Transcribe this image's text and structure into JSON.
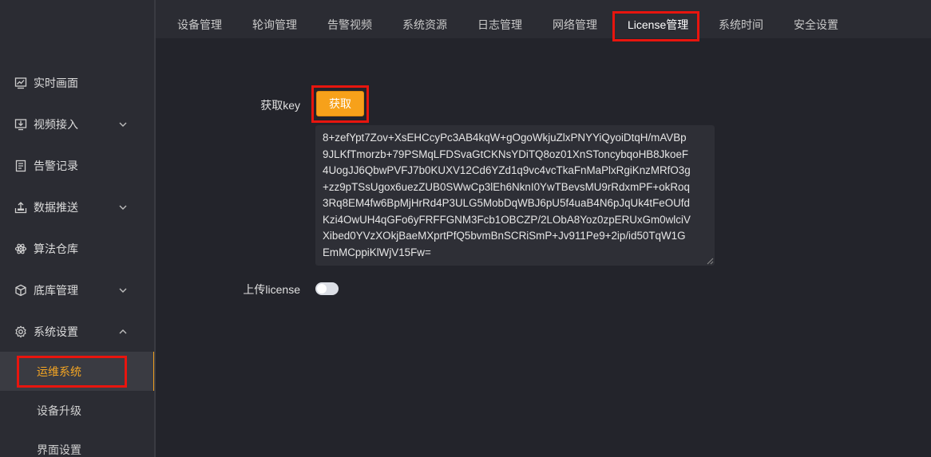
{
  "sidebar": {
    "items": [
      {
        "label": "实时画面",
        "icon": "monitor-chart-icon"
      },
      {
        "label": "视频接入",
        "icon": "screen-download-icon",
        "expandable": true
      },
      {
        "label": "告警记录",
        "icon": "document-list-icon"
      },
      {
        "label": "数据推送",
        "icon": "upload-tray-icon",
        "expandable": true
      },
      {
        "label": "算法仓库",
        "icon": "atom-icon"
      },
      {
        "label": "底库管理",
        "icon": "cube-icon",
        "expandable": true
      },
      {
        "label": "系统设置",
        "icon": "gear-icon",
        "expandable": true,
        "expanded": true
      }
    ],
    "subitems": [
      {
        "label": "运维系统",
        "active": true
      },
      {
        "label": "设备升级"
      },
      {
        "label": "界面设置"
      }
    ]
  },
  "tabs": [
    {
      "label": "设备管理"
    },
    {
      "label": "轮询管理"
    },
    {
      "label": "告警视频"
    },
    {
      "label": "系统资源"
    },
    {
      "label": "日志管理"
    },
    {
      "label": "网络管理"
    },
    {
      "label": "License管理",
      "active": true
    },
    {
      "label": "系统时间"
    },
    {
      "label": "安全设置"
    }
  ],
  "license": {
    "get_key_label": "获取key",
    "get_key_button": "获取",
    "key_text": "8+zefYpt7Zov+XsEHCcyPc3AB4kqW+gOgoWkjuZlxPNYYiQyoiDtqH/mAVBp\n9JLKfTmorzb+79PSMqLFDSvaGtCKNsYDiTQ8oz01XnSToncybqoHB8JkoeF\n4UogJJ6QbwPVFJ7b0KUXV12Cd6YZd1q9vc4vcTkaFnMaPlxRgiKnzMRfO3g\n+zz9pTSsUgox6uezZUB0SWwCp3lEh6NknI0YwTBevsMU9rRdxmPF+okRoq\n3Rq8EM4fw6BpMjHrRd4P3ULG5MobDqWBJ6pU5f4uaB4N6pJqUk4tFeOUfd\nKzi4OwUH4qGFo6yFRFFGNM3Fcb1OBCZP/2LObA8Yoz0zpERUxGm0wlciV\nXibed0YVzXOkjBaeMXprtPfQ5bvmBnSCRiSmP+Jv911Pe9+2ip/id50TqW1G\nEmMCppiKlWjV15Fw=",
    "upload_label": "上传license",
    "upload_enabled": false
  },
  "colors": {
    "accent": "#f7a11a",
    "highlight_box": "#e8150e",
    "sidebar_bg": "#2b2c33",
    "content_bg": "#23242b"
  }
}
